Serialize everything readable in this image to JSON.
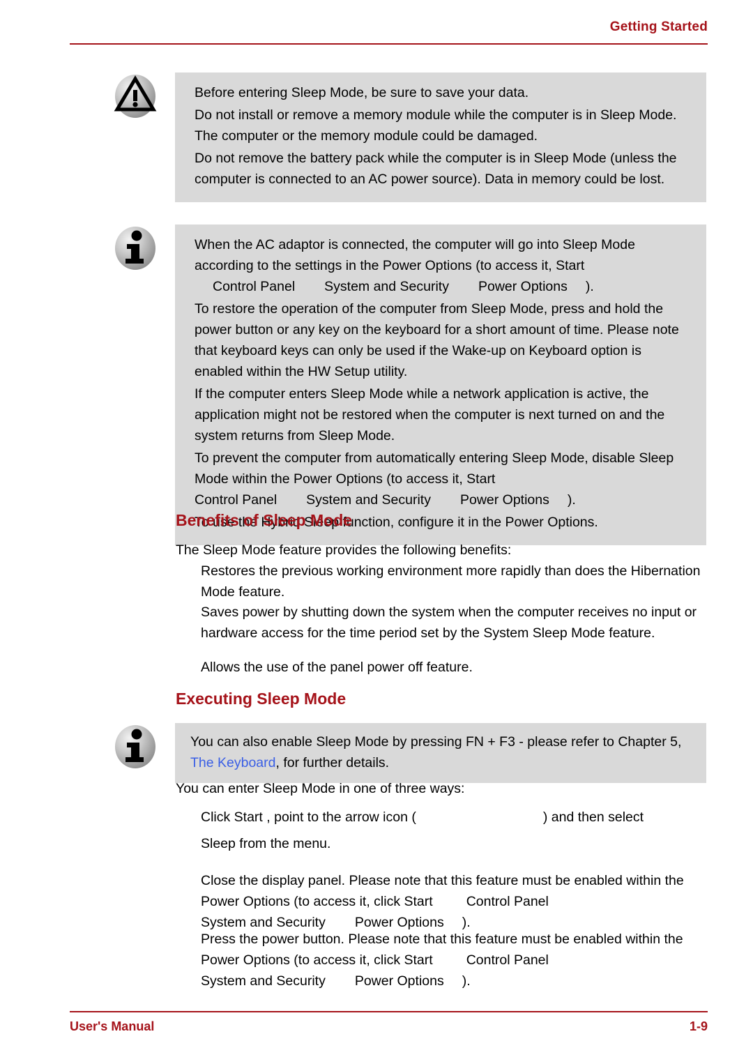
{
  "header": {
    "title": "Getting Started"
  },
  "footer": {
    "left_label": "User's Manual",
    "page_number": "1-9"
  },
  "warning_notice": {
    "icon": "warning-triangle-icon",
    "paragraphs": [
      "Before entering Sleep Mode, be sure to save your data.",
      "Do not install or remove a memory module while the computer is in Sleep Mode. The computer or the memory module could be damaged.",
      "Do not remove the battery pack while the computer is in Sleep Mode (unless the computer is connected to an AC power source). Data in memory could be lost."
    ]
  },
  "info_notice_1": {
    "icon": "info-i-icon",
    "para_1_a": "When the AC adaptor is connected, the computer will go into Sleep Mode according to the settings in the Power Options (to access it, Start",
    "para_1_b": "Control Panel",
    "para_1_c": "System and Security",
    "para_1_d": "Power Options",
    "para_1_e": ").",
    "para_2": "To restore the operation of the computer from Sleep Mode, press and hold the power button or any key on the keyboard for a short amount of time. Please note that keyboard keys can only be used if the Wake-up on Keyboard option is enabled within the HW Setup utility.",
    "para_3": "If the computer enters Sleep Mode while a network application is active, the application might not be restored when the computer is next turned on and the system returns from Sleep Mode.",
    "para_4_a": "To prevent the computer from automatically entering Sleep Mode, disable Sleep Mode within the Power Options (to access it, Start",
    "para_4_b": "Control Panel",
    "para_4_c": "System and Security",
    "para_4_d": "Power Options",
    "para_4_e": ").",
    "para_5": "To use the Hybrid Sleep function, configure it in the Power Options."
  },
  "benefits_section": {
    "heading": "Benefits of Sleep Mode",
    "intro": "The Sleep Mode feature provides the following benefits:",
    "items": [
      "Restores the previous working environment more rapidly than does the Hibernation Mode feature.",
      "Saves power by shutting down the system when the computer receives no input or hardware access for the time period set by the System Sleep Mode feature.",
      "Allows the use of the panel power off feature."
    ]
  },
  "executing_section": {
    "heading": "Executing Sleep Mode",
    "info_notice": {
      "icon": "info-i-icon",
      "text_before_link": "You can also enable Sleep Mode by pressing FN + F3 - please refer to Chapter 5, ",
      "link_text": "The Keyboard",
      "text_after_link": ", for further details."
    },
    "intro": "You can enter Sleep Mode in one of three ways:",
    "item_1_a": "Click Start , point to the arrow icon (",
    "item_1_b": ") and then select",
    "item_1_c": "Sleep  from the menu.",
    "item_2_a": "Close the display panel. Please note that this feature must be enabled within the Power Options (to access it, click Start",
    "item_2_b": "Control Panel",
    "item_2_c": "System and Security",
    "item_2_d": "Power Options",
    "item_2_e": ").",
    "item_3_a": "Press the power button. Please note that this feature must be enabled within the Power Options (to access it, click Start",
    "item_3_b": "Control Panel",
    "item_3_c": "System and Security",
    "item_3_d": "Power Options",
    "item_3_e": ")."
  },
  "colors": {
    "accent_red": "#a51219",
    "notice_background": "#d9d9d9",
    "link_blue": "#3a5fe5",
    "body_text": "#000000"
  }
}
